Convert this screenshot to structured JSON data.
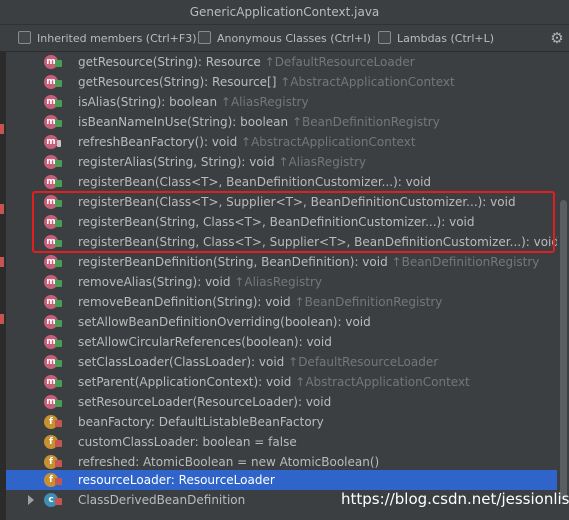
{
  "window": {
    "title": "GenericApplicationContext.java"
  },
  "options": {
    "inherited": "Inherited members (Ctrl+F3)",
    "anonymous": "Anonymous Classes (Ctrl+I)",
    "lambdas": "Lambdas (Ctrl+L)"
  },
  "members": [
    {
      "name": "getResource(String): Resource",
      "sub": "↑DefaultResourceLoader"
    },
    {
      "name": "getResources(String): Resource[]",
      "sub": "↑AbstractApplicationContext"
    },
    {
      "name": "isAlias(String): boolean",
      "sub": "↑AliasRegistry"
    },
    {
      "name": "isBeanNameInUse(String): boolean",
      "sub": "↑BeanDefinitionRegistry"
    },
    {
      "name": "refreshBeanFactory(): void",
      "sub": "↑AbstractApplicationContext"
    },
    {
      "name": "registerAlias(String, String): void",
      "sub": "↑AliasRegistry"
    },
    {
      "name": "registerBean(Class<T>, BeanDefinitionCustomizer...): void",
      "sub": ""
    },
    {
      "name": "registerBean(Class<T>, Supplier<T>, BeanDefinitionCustomizer...): void",
      "sub": ""
    },
    {
      "name": "registerBean(String, Class<T>, BeanDefinitionCustomizer...): void",
      "sub": ""
    },
    {
      "name": "registerBean(String, Class<T>, Supplier<T>, BeanDefinitionCustomizer...): void",
      "sub": ""
    },
    {
      "name": "registerBeanDefinition(String, BeanDefinition): void",
      "sub": "↑BeanDefinitionRegistry"
    },
    {
      "name": "removeAlias(String): void",
      "sub": "↑AliasRegistry"
    },
    {
      "name": "removeBeanDefinition(String): void",
      "sub": "↑BeanDefinitionRegistry"
    },
    {
      "name": "setAllowBeanDefinitionOverriding(boolean): void",
      "sub": ""
    },
    {
      "name": "setAllowCircularReferences(boolean): void",
      "sub": ""
    },
    {
      "name": "setClassLoader(ClassLoader): void",
      "sub": "↑DefaultResourceLoader"
    },
    {
      "name": "setParent(ApplicationContext): void",
      "sub": "↑AbstractApplicationContext"
    },
    {
      "name": "setResourceLoader(ResourceLoader): void",
      "sub": ""
    },
    {
      "name": "beanFactory: DefaultListableBeanFactory",
      "sub": ""
    },
    {
      "name": "customClassLoader: boolean = false",
      "sub": ""
    },
    {
      "name": "refreshed: AtomicBoolean = new AtomicBoolean()",
      "sub": ""
    },
    {
      "name": "resourceLoader: ResourceLoader",
      "sub": ""
    },
    {
      "name": "ClassDerivedBeanDefinition",
      "sub": ""
    }
  ],
  "icons": {
    "method": "m",
    "field": "f",
    "class": "c",
    "gear": "⚙"
  },
  "watermark": "https://blog.csdn.net/jessionlist",
  "colors": {
    "selected_row": "#2f65ca",
    "highlight_box": "#e02020"
  }
}
